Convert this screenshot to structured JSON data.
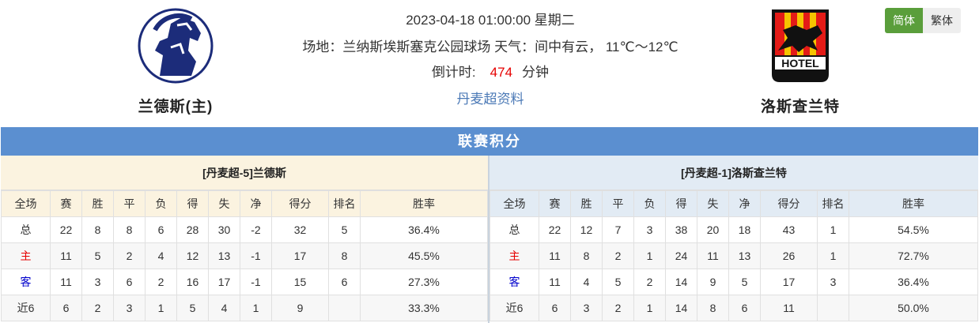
{
  "match": {
    "datetime": "2023-04-18 01:00:00 星期二",
    "venue_line": "场地：兰纳斯埃斯塞克公园球场 天气：间中有云， 11℃～12℃",
    "countdown_label": "倒计时:",
    "countdown_value": "474",
    "countdown_unit": "分钟",
    "league_link": "丹麦超资料"
  },
  "home_team": {
    "name": "兰德斯(主)",
    "logo_icon": "randers-fc-horse-logo-icon",
    "logo_color": "#1c2c7a"
  },
  "away_team": {
    "name": "洛斯查兰特",
    "logo_icon": "fc-nordsjaelland-hotel-logo-icon",
    "logo_color": "#e41b17"
  },
  "lang": {
    "simplified": "简体",
    "traditional": "繁体",
    "active_color": "#5a9e3b"
  },
  "standings": {
    "title": "联赛积分",
    "columns": [
      "全场",
      "赛",
      "胜",
      "平",
      "负",
      "得",
      "失",
      "净",
      "得分",
      "排名",
      "胜率"
    ],
    "home": {
      "header": "[丹麦超-5]兰德斯",
      "rows": [
        [
          "总",
          "22",
          "8",
          "8",
          "6",
          "28",
          "30",
          "-2",
          "32",
          "5",
          "36.4%"
        ],
        [
          "主",
          "11",
          "5",
          "2",
          "4",
          "12",
          "13",
          "-1",
          "17",
          "8",
          "45.5%"
        ],
        [
          "客",
          "11",
          "3",
          "6",
          "2",
          "16",
          "17",
          "-1",
          "15",
          "6",
          "27.3%"
        ],
        [
          "近6",
          "6",
          "2",
          "3",
          "1",
          "5",
          "4",
          "1",
          "9",
          "",
          "33.3%"
        ]
      ]
    },
    "away": {
      "header": "[丹麦超-1]洛斯查兰特",
      "rows": [
        [
          "总",
          "22",
          "12",
          "7",
          "3",
          "38",
          "20",
          "18",
          "43",
          "1",
          "54.5%"
        ],
        [
          "主",
          "11",
          "8",
          "2",
          "1",
          "24",
          "11",
          "13",
          "26",
          "1",
          "72.7%"
        ],
        [
          "客",
          "11",
          "4",
          "5",
          "2",
          "14",
          "9",
          "5",
          "17",
          "3",
          "36.4%"
        ],
        [
          "近6",
          "6",
          "3",
          "2",
          "1",
          "14",
          "8",
          "6",
          "11",
          "",
          "50.0%"
        ]
      ]
    }
  }
}
